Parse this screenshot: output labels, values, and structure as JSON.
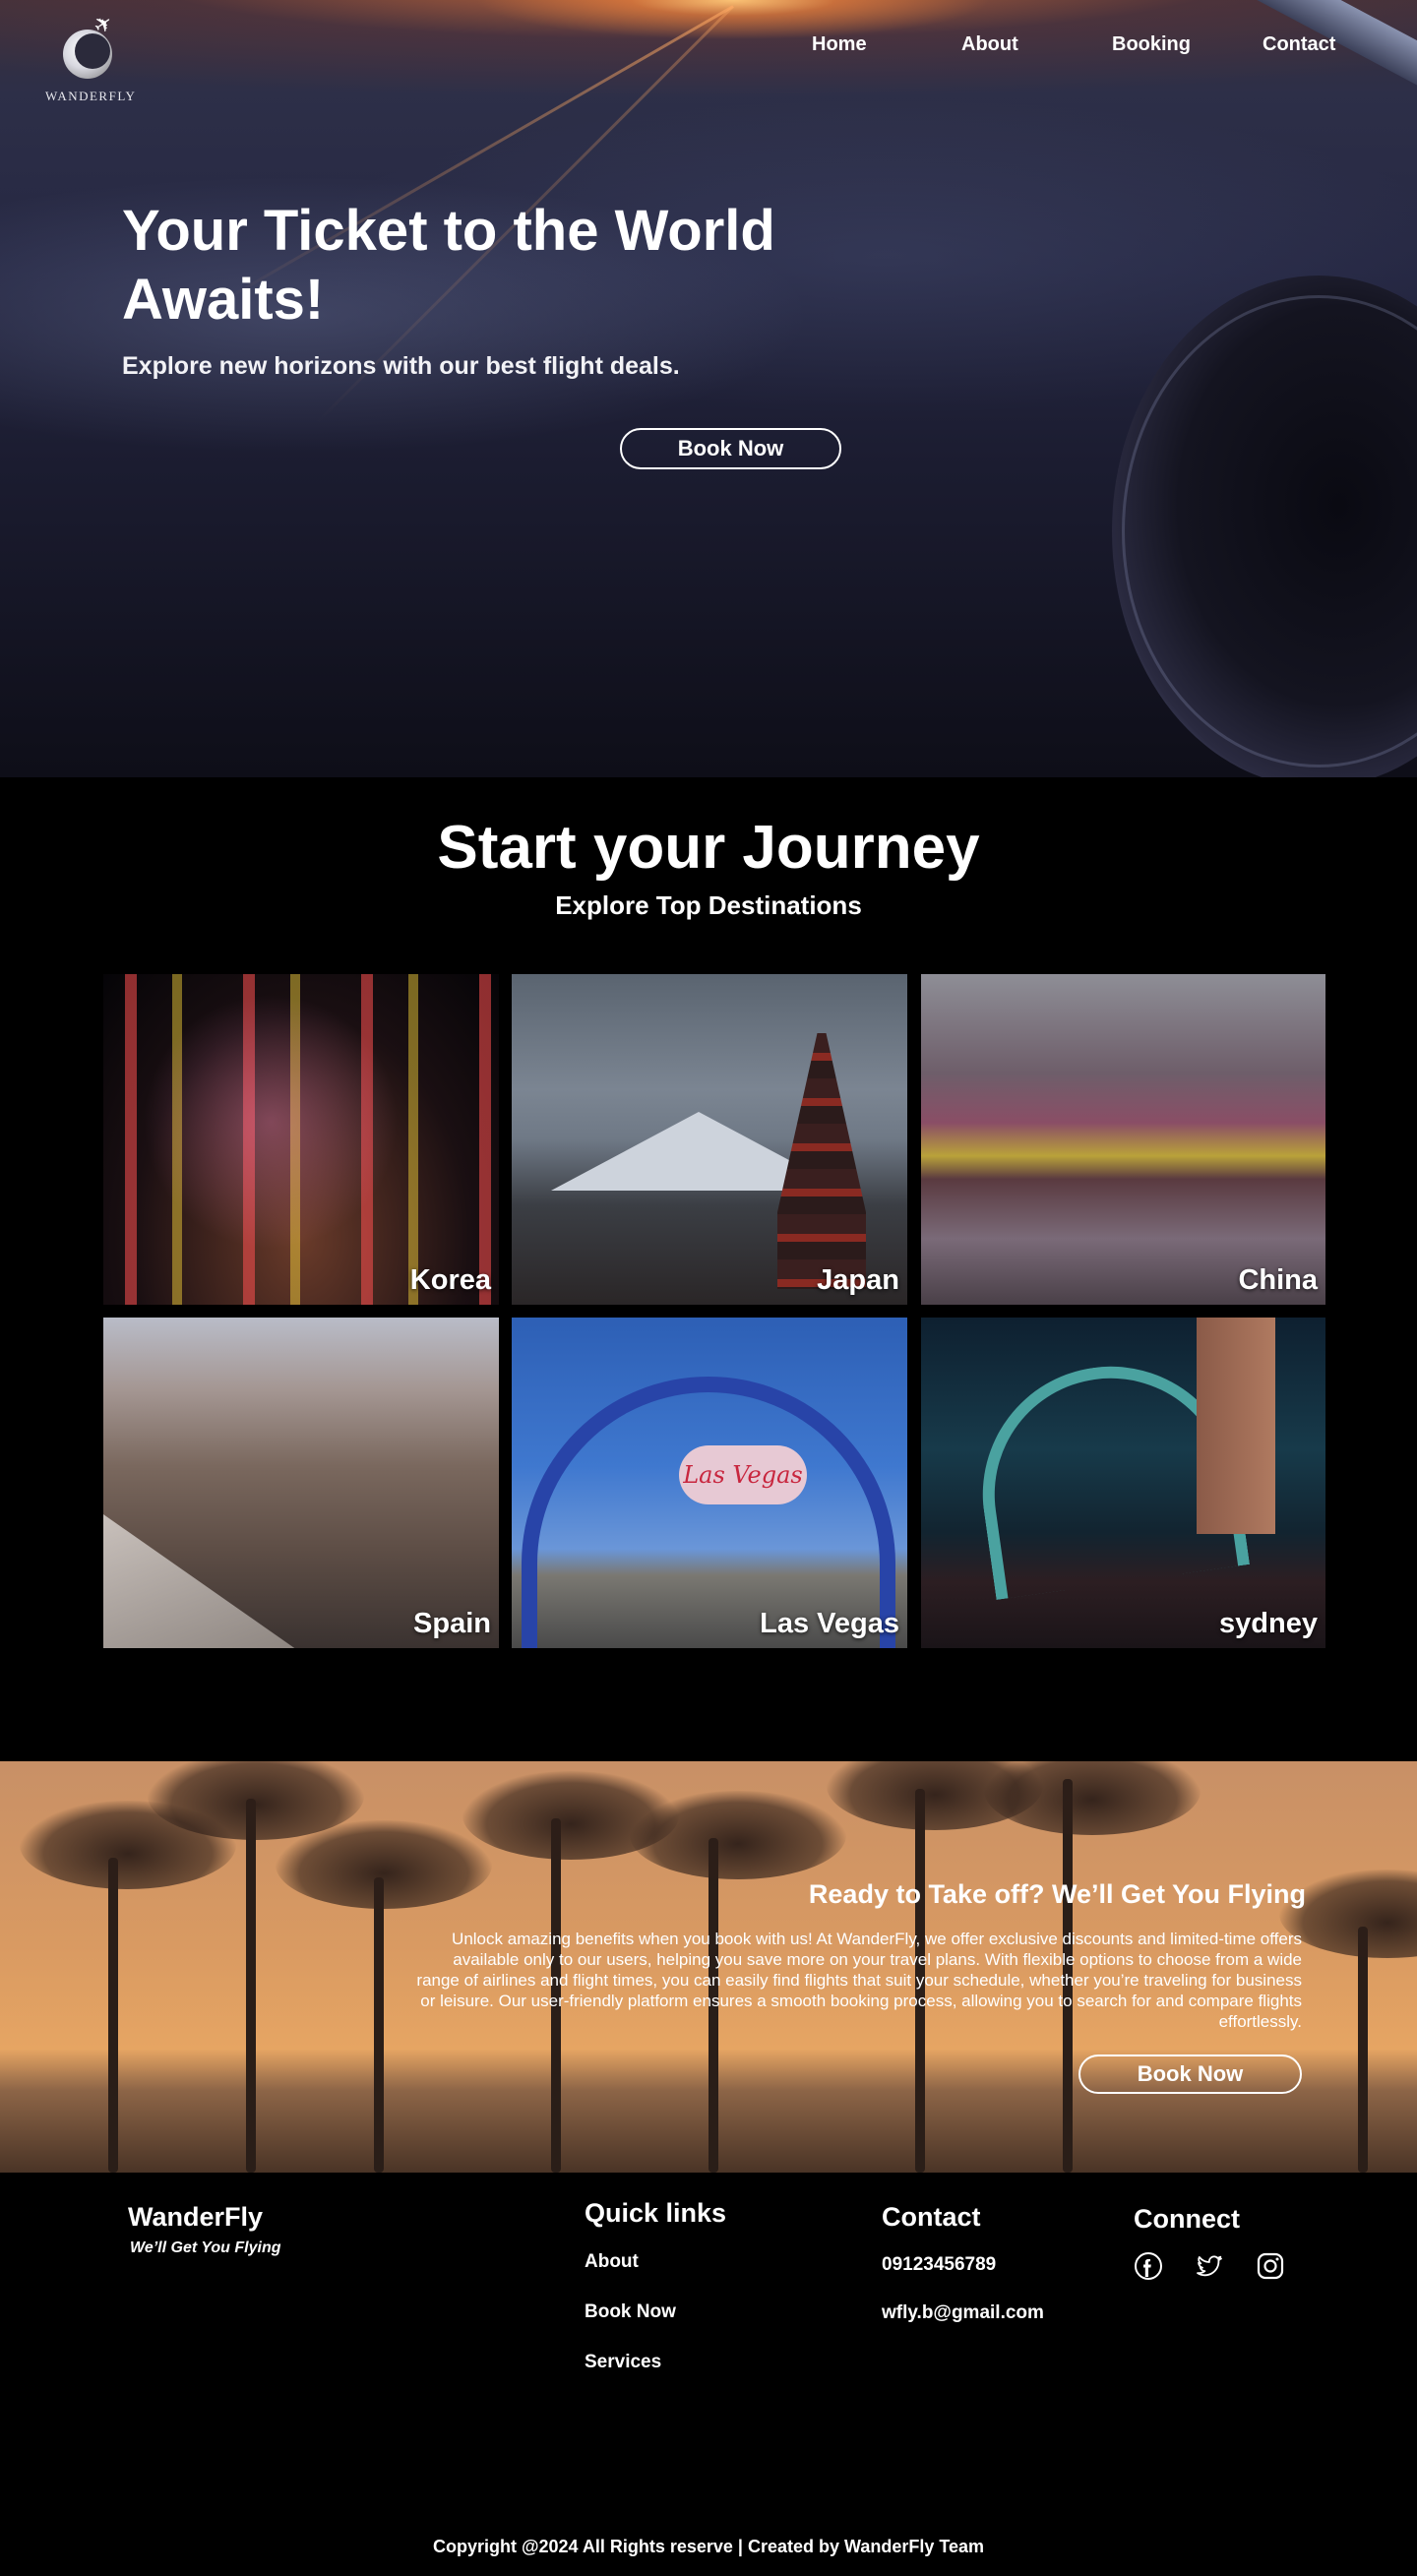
{
  "brand": {
    "logo_text": "WANDERFLY"
  },
  "nav": {
    "items": [
      "Home",
      "About",
      "Booking",
      "Contact"
    ]
  },
  "hero": {
    "title": "Your Ticket to the World Awaits!",
    "subtitle": "Explore new horizons with our best flight deals.",
    "button": "Book Now"
  },
  "journey": {
    "title": "Start your Journey",
    "subtitle": "Explore Top Destinations",
    "destinations": [
      "Korea",
      "Japan",
      "China",
      "Spain",
      "Las Vegas",
      "sydney"
    ],
    "vegas_sign": "Las Vegas"
  },
  "cta": {
    "title": "Ready to Take off? We’ll Get You Flying",
    "body": "Unlock amazing benefits when you book with us! At WanderFly, we offer exclusive discounts and limited-time offers available only to our users, helping you save more on your travel plans. With flexible options to choose from a wide range of airlines and flight times, you can easily find flights that suit your schedule, whether you’re traveling for business or leisure. Our user-friendly platform ensures a smooth booking process, allowing you to search for and compare flights effortlessly.",
    "button": "Book Now"
  },
  "footer": {
    "brand": "WanderFly",
    "tagline": "We’ll Get You Flying",
    "quick_links_title": "Quick links",
    "quick_links": [
      "About",
      "Book Now",
      "Services"
    ],
    "contact_title": "Contact",
    "phone": "09123456789",
    "email": "wfly.b@gmail.com",
    "connect_title": "Connect",
    "social_icons": [
      "facebook-icon",
      "twitter-icon",
      "instagram-icon"
    ],
    "copyright": "Copyright @2024 All Rights reserve | Created by WanderFly Team"
  }
}
